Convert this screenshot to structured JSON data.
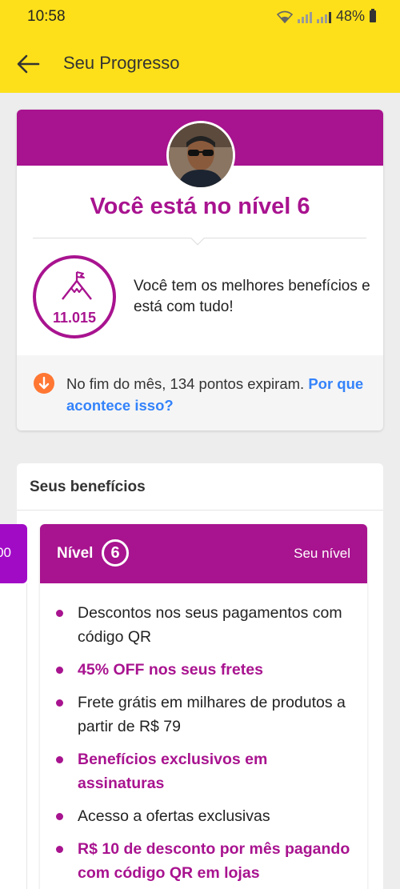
{
  "status_bar": {
    "time": "10:58",
    "battery": "48%"
  },
  "app_bar": {
    "title": "Seu Progresso",
    "back_icon": "arrow-left-icon"
  },
  "level_card": {
    "title": "Você está no nível 6",
    "points": "11.015",
    "points_icon": "mountain-flag-icon",
    "description": "Você tem os melhores benefícios e está com tudo!",
    "expire_text": "No fim do mês, 134 pontos expiram.",
    "expire_link": "Por que acontece isso?",
    "expire_icon": "arrow-down-circle-icon"
  },
  "benefits_card": {
    "title": "Seus benefícios",
    "previous_tier_label": "00",
    "tier": {
      "label": "Nível",
      "number": "6",
      "current_label": "Seu nível",
      "items": [
        {
          "text": "Descontos nos seus pagamentos com código QR",
          "highlight": false
        },
        {
          "text": "45% OFF nos seus fretes",
          "highlight": true
        },
        {
          "text": "Frete grátis em milhares de produtos a partir de R$ 79",
          "highlight": false
        },
        {
          "text": "Benefícios exclusivos em assinaturas",
          "highlight": true
        },
        {
          "text": "Acesso a ofertas exclusivas",
          "highlight": false
        },
        {
          "text": "R$ 10 de desconto por mês pagando com código QR em lojas",
          "highlight": true
        }
      ]
    }
  },
  "colors": {
    "brand_yellow": "#fde01a",
    "brand_purple": "#a8138f",
    "link_blue": "#3483fa",
    "warning_orange": "#ff7733"
  }
}
